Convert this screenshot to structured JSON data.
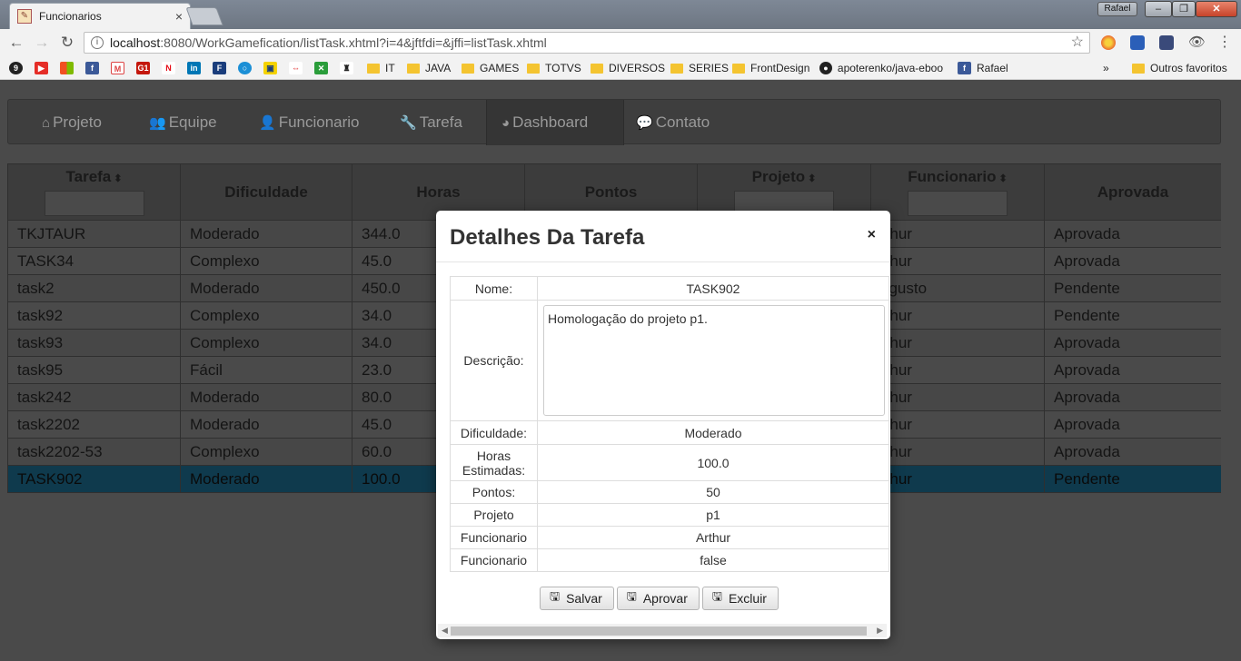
{
  "browser": {
    "tab_title": "Funcionarios",
    "tab_close": "×",
    "user_label": "Rafael",
    "url_host": "localhost",
    "url_rest": ":8080/WorkGamefication/listTask.xhtml?i=4&jftfdi=&jffi=listTask.xhtml",
    "bookmarks": [
      "IT",
      "JAVA",
      "GAMES",
      "TOTVS",
      "DIVERSOS",
      "SERIES",
      "FrontDesign",
      "apoterenko/java-eboo",
      "Rafael"
    ],
    "bookmarks_overflow": "»",
    "other_bookmarks": "Outros favoritos"
  },
  "nav": {
    "items": [
      {
        "label": "Projeto",
        "icon": "home-icon",
        "glyph": "⌂"
      },
      {
        "label": "Equipe",
        "icon": "users-icon",
        "glyph": "👥"
      },
      {
        "label": "Funcionario",
        "icon": "user-icon",
        "glyph": "👤"
      },
      {
        "label": "Tarefa",
        "icon": "wrench-icon",
        "glyph": "🔧"
      },
      {
        "label": "Dashboard",
        "icon": "pie-chart-icon",
        "glyph": "◕"
      },
      {
        "label": "Contato",
        "icon": "chat-icon",
        "glyph": "💬"
      }
    ],
    "active": "Dashboard"
  },
  "grid": {
    "headers": [
      {
        "label": "Tarefa",
        "sortable": true,
        "filter": true
      },
      {
        "label": "Dificuldade",
        "sortable": false,
        "filter": false
      },
      {
        "label": "Horas",
        "sortable": false,
        "filter": false
      },
      {
        "label": "Pontos",
        "sortable": false,
        "filter": false
      },
      {
        "label": "Projeto",
        "sortable": true,
        "filter": true
      },
      {
        "label": "Funcionario",
        "sortable": true,
        "filter": true
      },
      {
        "label": "Aprovada",
        "sortable": false,
        "filter": false
      }
    ],
    "rows": [
      {
        "tarefa": "TKJTAUR",
        "dificuldade": "Moderado",
        "horas": "344.0",
        "pontos": "",
        "projeto": "",
        "funcionario": "rthur",
        "aprovada": "Aprovada"
      },
      {
        "tarefa": "TASK34",
        "dificuldade": "Complexo",
        "horas": "45.0",
        "pontos": "",
        "projeto": "",
        "funcionario": "rthur",
        "aprovada": "Aprovada"
      },
      {
        "tarefa": "task2",
        "dificuldade": "Moderado",
        "horas": "450.0",
        "pontos": "",
        "projeto": "",
        "funcionario": "ugusto",
        "aprovada": "Pendente"
      },
      {
        "tarefa": "task92",
        "dificuldade": "Complexo",
        "horas": "34.0",
        "pontos": "",
        "projeto": "",
        "funcionario": "rthur",
        "aprovada": "Pendente"
      },
      {
        "tarefa": "task93",
        "dificuldade": "Complexo",
        "horas": "34.0",
        "pontos": "",
        "projeto": "",
        "funcionario": "rthur",
        "aprovada": "Aprovada"
      },
      {
        "tarefa": "task95",
        "dificuldade": "Fácil",
        "horas": "23.0",
        "pontos": "",
        "projeto": "",
        "funcionario": "rthur",
        "aprovada": "Aprovada"
      },
      {
        "tarefa": "task242",
        "dificuldade": "Moderado",
        "horas": "80.0",
        "pontos": "",
        "projeto": "",
        "funcionario": "rthur",
        "aprovada": "Aprovada"
      },
      {
        "tarefa": "task2202",
        "dificuldade": "Moderado",
        "horas": "45.0",
        "pontos": "",
        "projeto": "",
        "funcionario": "rthur",
        "aprovada": "Aprovada"
      },
      {
        "tarefa": "task2202-53",
        "dificuldade": "Complexo",
        "horas": "60.0",
        "pontos": "",
        "projeto": "",
        "funcionario": "rthur",
        "aprovada": "Aprovada"
      },
      {
        "tarefa": "TASK902",
        "dificuldade": "Moderado",
        "horas": "100.0",
        "pontos": "",
        "projeto": "",
        "funcionario": "rthur",
        "aprovada": "Pendente",
        "selected": true
      }
    ]
  },
  "modal": {
    "title": "Detalhes Da Tarefa",
    "close": "×",
    "fields": {
      "nome_label": "Nome:",
      "nome_value": "TASK902",
      "descricao_label": "Descrição:",
      "descricao_value": "Homologação do projeto p1.",
      "dificuldade_label": "Dificuldade:",
      "dificuldade_value": "Moderado",
      "horas_label": "Horas Estimadas:",
      "horas_value": "100.0",
      "pontos_label": "Pontos:",
      "pontos_value": "50",
      "projeto_label": "Projeto",
      "projeto_value": "p1",
      "funcionario_label": "Funcionario",
      "funcionario_value": "Arthur",
      "funcionario2_label": "Funcionario",
      "funcionario2_value": "false"
    },
    "buttons": {
      "save": "Salvar",
      "approve": "Aprovar",
      "delete": "Excluir"
    }
  },
  "colors": {
    "selected_row": "#0f3a4d",
    "overlay": "#4a4a4a"
  }
}
